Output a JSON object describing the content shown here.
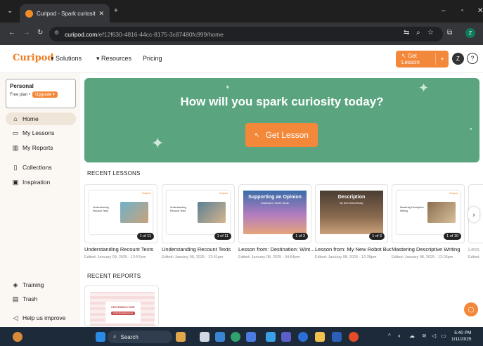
{
  "browser": {
    "tab_title": "Curipod - Spark curiosity with i",
    "tab_close": "✕",
    "new_tab": "+",
    "url_host": "curipod.com",
    "url_path": "/ef12f630-4816-44cc-8175-3c87480fc999/home",
    "profile_initial": "Z"
  },
  "app": {
    "logo": "Curipod",
    "menu": [
      {
        "label": "Solutions"
      },
      {
        "label": "Resources"
      },
      {
        "label": "Pricing"
      }
    ],
    "get_lesson_label": "Get Lesson",
    "user_initial": "Z",
    "help_label": "?"
  },
  "sidebar": {
    "plan_name": "Personal",
    "plan_line": "Free plan •",
    "upgrade_label": "Upgrade ▾",
    "items": [
      {
        "label": "Home",
        "icon": "home-icon"
      },
      {
        "label": "My Lessons",
        "icon": "folder-icon"
      },
      {
        "label": "My Reports",
        "icon": "bar-chart-icon"
      },
      {
        "label": "Collections",
        "icon": "bookmark-icon"
      },
      {
        "label": "Inspiration",
        "icon": "book-icon"
      },
      {
        "label": "Training",
        "icon": "graduation-cap-icon"
      },
      {
        "label": "Trash",
        "icon": "trash-icon"
      },
      {
        "label": "Help us improve",
        "icon": "megaphone-icon"
      }
    ]
  },
  "hero": {
    "title": "How will you spark curiosity today?",
    "button_label": "Get Lesson"
  },
  "recent_lessons": {
    "heading": "RECENT LESSONS",
    "cards": [
      {
        "title": "Understanding Recount Texts",
        "edited": "Edited: January 09, 2025 - 12:57pm",
        "badge": "1 of 11",
        "thumb_text": "Understanding Recount Texts"
      },
      {
        "title": "Understanding Recount Texts",
        "edited": "Edited: January 09, 2025 - 12:51pm",
        "badge": "1 of 11",
        "thumb_text": "Understanding Recount Texts"
      },
      {
        "title": "Lesson from: Destination: Wint...",
        "edited": "Edited: January 08, 2025 - 04:54pm",
        "badge": "1 of 3",
        "thumb_text": "Supporting an Opinion",
        "thumb_sub": "Destination: Winter Break"
      },
      {
        "title": "Lesson from: My New Robot Budd...",
        "edited": "Edited: January 08, 2025 - 12:28pm",
        "badge": "1 of 3",
        "thumb_text": "Description",
        "thumb_sub": "My New Robot Buddy"
      },
      {
        "title": "Mastering Descriptive Writing",
        "edited": "Edited: January 08, 2025 - 12:26pm",
        "badge": "1 of 10",
        "thumb_text": "Mastering Descriptive Writing"
      },
      {
        "title": "Less",
        "edited": "Edited"
      }
    ],
    "brand_mark": "Curipod"
  },
  "recent_reports": {
    "heading": "RECENT REPORTS",
    "cards": [
      {
        "thumb_title": "DESCRIBING HOME",
        "thumb_sub": "Understanding Home"
      }
    ]
  },
  "taskbar": {
    "search_label": "Search",
    "time": "5:40 PM",
    "date": "1/11/2025"
  },
  "colors": {
    "accent": "#f4883a",
    "hero_bg": "#5aa57f",
    "sidebar_bg": "#fbf7f2"
  }
}
